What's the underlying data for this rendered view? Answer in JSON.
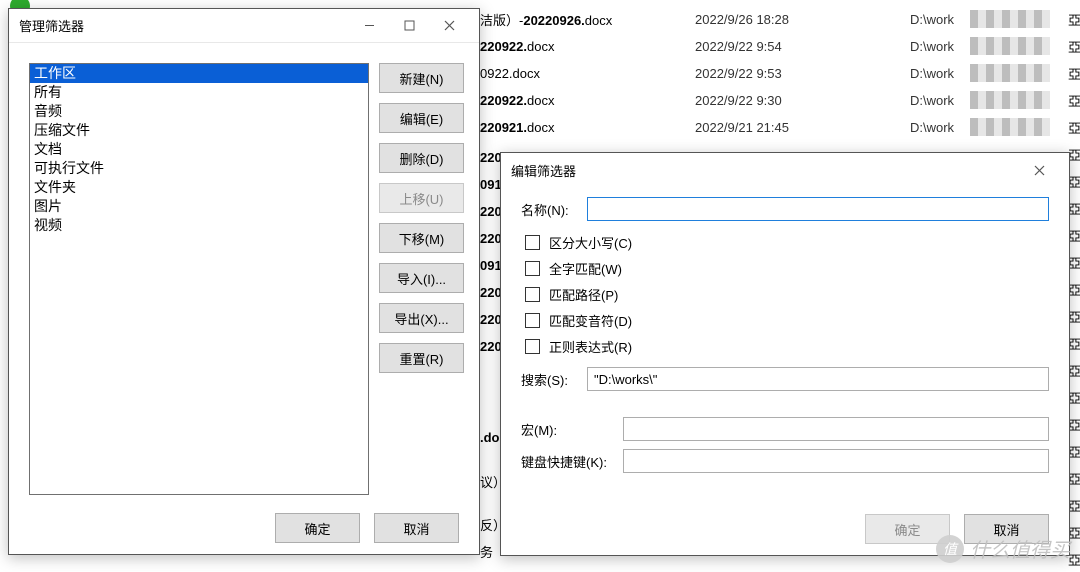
{
  "bg_rows": [
    {
      "name_prefix": "洁版）-",
      "name_bold": "20220926.",
      "ext": "docx",
      "date": "2022/9/26 18:28",
      "path": "D:\\work"
    },
    {
      "name_prefix": "",
      "name_bold": "220922.",
      "ext": "docx",
      "date": "2022/9/22 9:54",
      "path": "D:\\work"
    },
    {
      "name_prefix": "0922.",
      "name_bold": "",
      "ext": "docx",
      "date": "2022/9/22 9:53",
      "path": "D:\\work"
    },
    {
      "name_prefix": "",
      "name_bold": "220922.",
      "ext": "docx",
      "date": "2022/9/22 9:30",
      "path": "D:\\work"
    },
    {
      "name_prefix": "",
      "name_bold": "220921.",
      "ext": "docx",
      "date": "2022/9/21 21:45",
      "path": "D:\\work"
    }
  ],
  "partial_col": [
    "220",
    "091",
    "220",
    "220",
    "091",
    "220",
    "220",
    "220"
  ],
  "partial_below": [
    ".do",
    "议）",
    "反）",
    "务"
  ],
  "manage": {
    "title": "管理筛选器",
    "items": [
      "工作区",
      "所有",
      "音频",
      "压缩文件",
      "文档",
      "可执行文件",
      "文件夹",
      "图片",
      "视频"
    ],
    "buttons": {
      "new": "新建(N)",
      "edit": "编辑(E)",
      "delete": "删除(D)",
      "up": "上移(U)",
      "down": "下移(M)",
      "import": "导入(I)...",
      "export": "导出(X)...",
      "reset": "重置(R)"
    },
    "ok": "确定",
    "cancel": "取消"
  },
  "edit": {
    "title": "编辑筛选器",
    "name_label": "名称(N):",
    "chk": {
      "case": "区分大小写(C)",
      "whole": "全字匹配(W)",
      "path": "匹配路径(P)",
      "diacritic": "匹配变音符(D)",
      "regex": "正则表达式(R)"
    },
    "search_label": "搜索(S):",
    "search_value": "\"D:\\works\\\"",
    "macro_label": "宏(M):",
    "hotkey_label": "键盘快捷键(K):",
    "ok": "确定",
    "cancel": "取消"
  },
  "watermark": "什么值得买"
}
